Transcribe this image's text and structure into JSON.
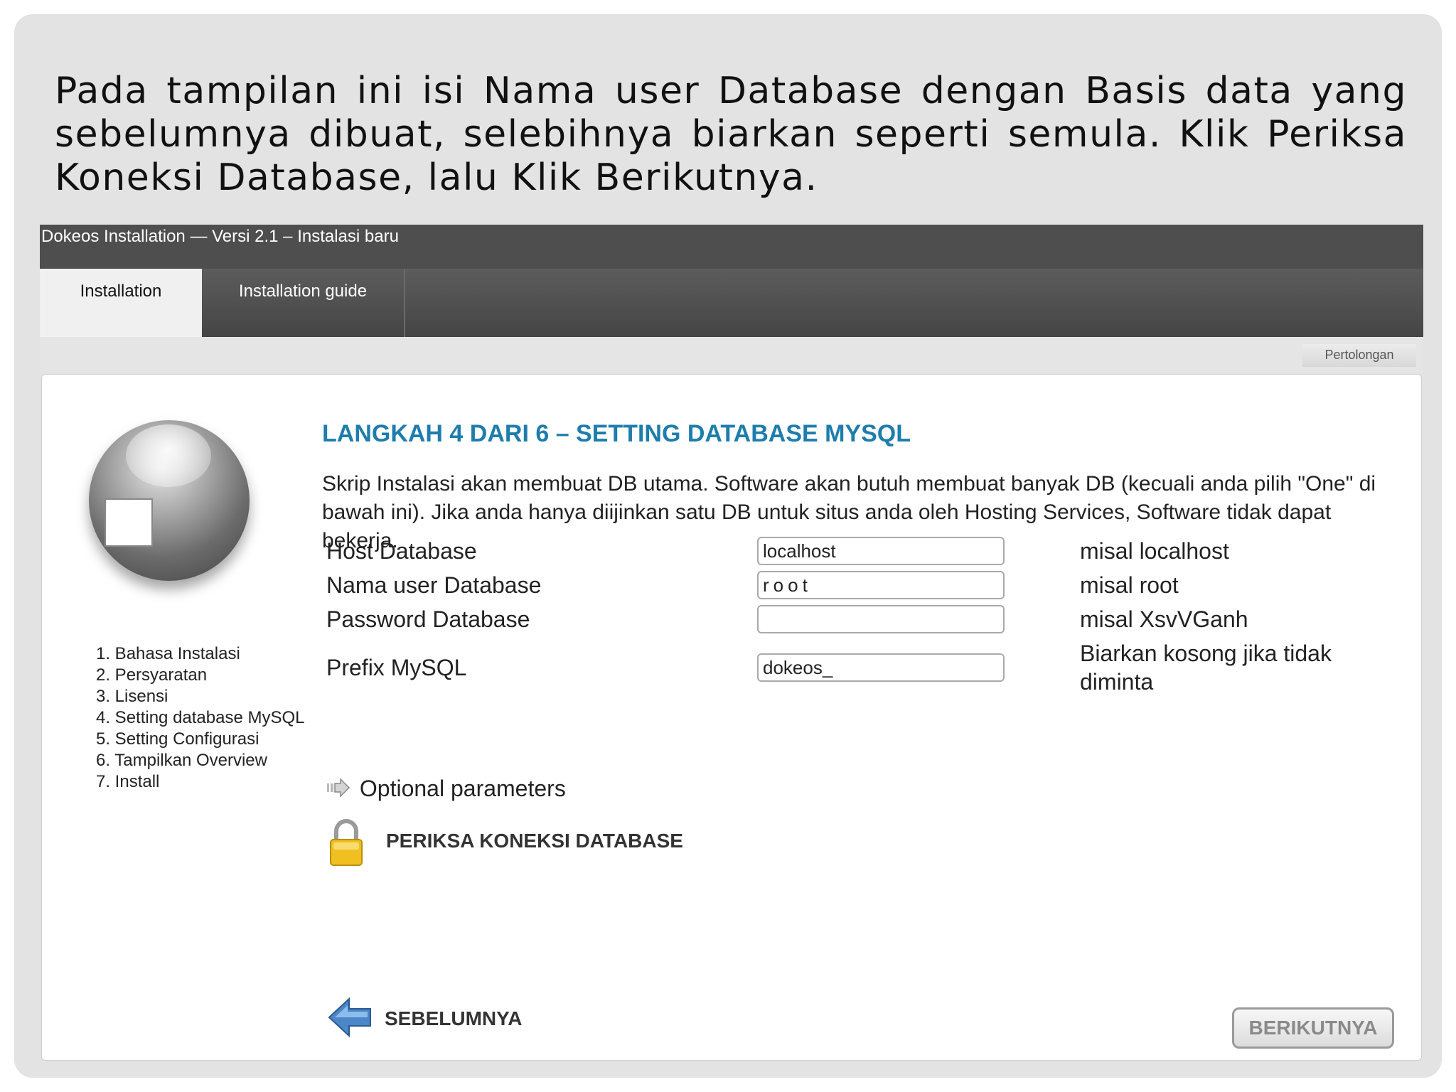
{
  "caption": "Pada tampilan ini isi Nama user Database dengan Basis data yang sebelumnya dibuat, selebihnya biarkan seperti semula. Klik Periksa Koneksi Database, lalu Klik Berikutnya.",
  "window": {
    "title": "Dokeos Installation — Versi 2.1 – Instalasi baru",
    "tabs": [
      {
        "label": "Installation",
        "active": true
      },
      {
        "label": "Installation guide",
        "active": false
      }
    ],
    "help_label": "Pertolongan"
  },
  "sidebar": {
    "logo_icon": "sphere-logo-icon",
    "steps": [
      "1. Bahasa Instalasi",
      "2. Persyaratan",
      "3. Lisensi",
      "4. Setting database MySQL",
      "5. Setting Configurasi",
      "6. Tampilkan Overview",
      "7. Install"
    ]
  },
  "main": {
    "heading": "LANGKAH 4 DARI 6 – SETTING DATABASE MYSQL",
    "description": "Skrip Instalasi akan membuat DB utama. Software akan butuh membuat banyak DB (kecuali anda pilih \"One\" di bawah ini). Jika anda hanya diijinkan satu DB untuk situs anda oleh Hosting Services, Software tidak dapat bekerja.",
    "fields": [
      {
        "label": "Host Database",
        "value": "localhost",
        "hint": "misal localhost"
      },
      {
        "label": "Nama user Database",
        "value": "root",
        "hint": "misal root"
      },
      {
        "label": "Password Database",
        "value": "",
        "hint": "misal XsvVGanh"
      },
      {
        "label": "Prefix MySQL",
        "value": "dokeos_",
        "hint": "Biarkan kosong jika tidak diminta"
      }
    ],
    "optional_label": "Optional parameters",
    "check_connection_label": "PERIKSA KONEKSI DATABASE",
    "previous_label": "SEBELUMNYA",
    "next_label": "BERIKUTNYA"
  },
  "colors": {
    "heading": "#1e7dac",
    "titlebar": "#4e4e4e",
    "lock": "#f0c020"
  }
}
